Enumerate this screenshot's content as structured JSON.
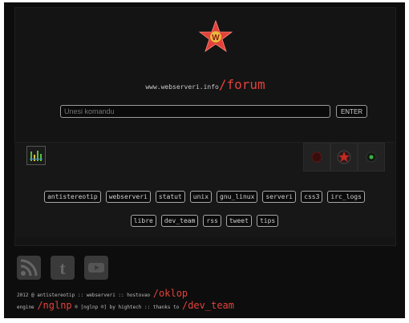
{
  "header": {
    "site_url": "www.webserveri.info",
    "forum_label": "/forum"
  },
  "command": {
    "placeholder": "Unesi komandu",
    "enter_label": "ENTER"
  },
  "tags_row1": [
    "antistereotip",
    "webserveri",
    "statut",
    "unix",
    "gnu_linux",
    "serveri",
    "css3",
    "irc_logs"
  ],
  "tags_row2": [
    "libre",
    "dev_team",
    "rss",
    "tweet",
    "tips"
  ],
  "footer": {
    "line1_prefix": "2012 @ antistereotip :: webserveri :: hostovao",
    "line1_accent": "/oklop",
    "line2_prefix": "engine",
    "line2_accent": "/nglnp",
    "line2_middle": "® [nglnp ®] by hightech :: thanks to",
    "line2_suffix": "/dev_team"
  },
  "colors": {
    "accent_red": "#e2413b",
    "background": "#0d0d0d",
    "panel": "#141414"
  },
  "icons": [
    "star-logo",
    "equalizer-icon",
    "theme-red-dot",
    "theme-star",
    "theme-green-dot",
    "rss-icon",
    "twitter-icon",
    "youtube-icon"
  ]
}
